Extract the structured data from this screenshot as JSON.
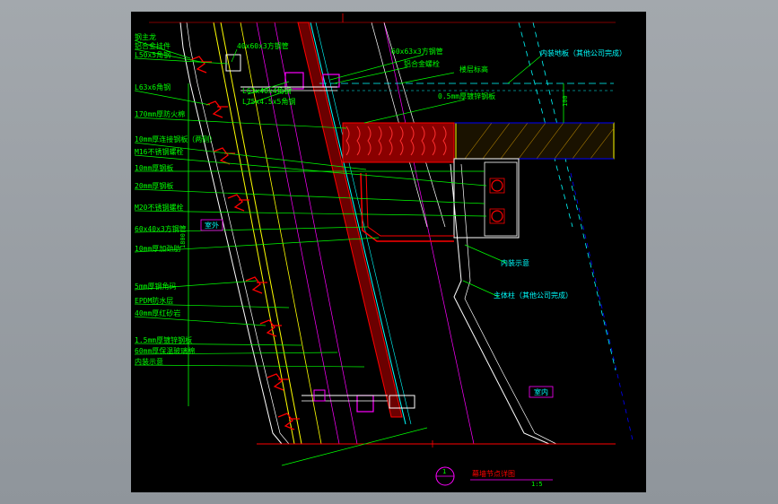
{
  "drawing": {
    "colors": {
      "background": "#000000",
      "frame": "#9aa0a5",
      "dimension": "#00ff00",
      "leader": "#00ff00",
      "label": "#00ff00",
      "steel": "#ff0000",
      "annotation_right": "#00ffff",
      "glass": "#00ffff",
      "structure": "#ffff00",
      "reference": "#0000ff",
      "insulation": "#ff00ff",
      "connector": "#ff00ff",
      "white": "#ffffff"
    },
    "left_labels": [
      {
        "id": "main-rib",
        "text": "钢主龙"
      },
      {
        "id": "alu-hanger",
        "text": "铝合金挂件"
      },
      {
        "id": "angle-l50",
        "text": "L50x5角钢"
      },
      {
        "id": "angle-l63",
        "text": "L63x6角钢"
      },
      {
        "id": "fireproof",
        "text": "170mm厚防火棉"
      },
      {
        "id": "conn-plate",
        "text": "10mm厚连接钢板（两侧）"
      },
      {
        "id": "bolt-m16",
        "text": "M16不锈钢螺栓"
      },
      {
        "id": "plate-10",
        "text": "10mm厚钢板"
      },
      {
        "id": "plate-20",
        "text": "20mm厚钢板"
      },
      {
        "id": "bolt-m20",
        "text": "M20不锈钢螺栓"
      },
      {
        "id": "tube-60x40",
        "text": "60x40x3方钢管"
      },
      {
        "id": "stiffener",
        "text": "10mm厚加劲肋"
      },
      {
        "id": "angle-code",
        "text": "5mm厚钢角码"
      },
      {
        "id": "epdm",
        "text": "EPDM防水层"
      },
      {
        "id": "mortar",
        "text": "40mm厚红砂岩"
      },
      {
        "id": "galv-sheet",
        "text": "1.5mm厚镀锌钢板"
      },
      {
        "id": "mineral-wool",
        "text": "60mm厚保温玻璃棉"
      },
      {
        "id": "interior-finish",
        "text": "内装示意"
      }
    ],
    "top_labels": [
      {
        "id": "tube-40x60",
        "text": "40x60x3方钢管"
      },
      {
        "id": "angle-l63x40",
        "text": "L63x40x4角钢"
      },
      {
        "id": "angle-l75",
        "text": "L75x4.5x5角钢"
      },
      {
        "id": "tube-60x63",
        "text": "60x63x3方钢管"
      },
      {
        "id": "alu-bolt",
        "text": "铝合金螺栓"
      },
      {
        "id": "floor-level",
        "text": "楼层标高"
      },
      {
        "id": "galv-plate",
        "text": "0.5mm厚镀锌钢板"
      }
    ],
    "right_labels": [
      {
        "id": "interior-floor",
        "text": "内装地板（其他公司完成）"
      },
      {
        "id": "interior-finish-right",
        "text": "内装示意"
      },
      {
        "id": "main-column",
        "text": "主体柱（其他公司完成）"
      }
    ],
    "zone_labels": {
      "outdoor": "室外",
      "indoor": "室内"
    },
    "dimensions": {
      "floor_gap": "100",
      "vertical_span": "1800"
    },
    "title_block": {
      "detail_number": "1",
      "title": "幕墙节点详图",
      "scale": "1:5"
    }
  }
}
